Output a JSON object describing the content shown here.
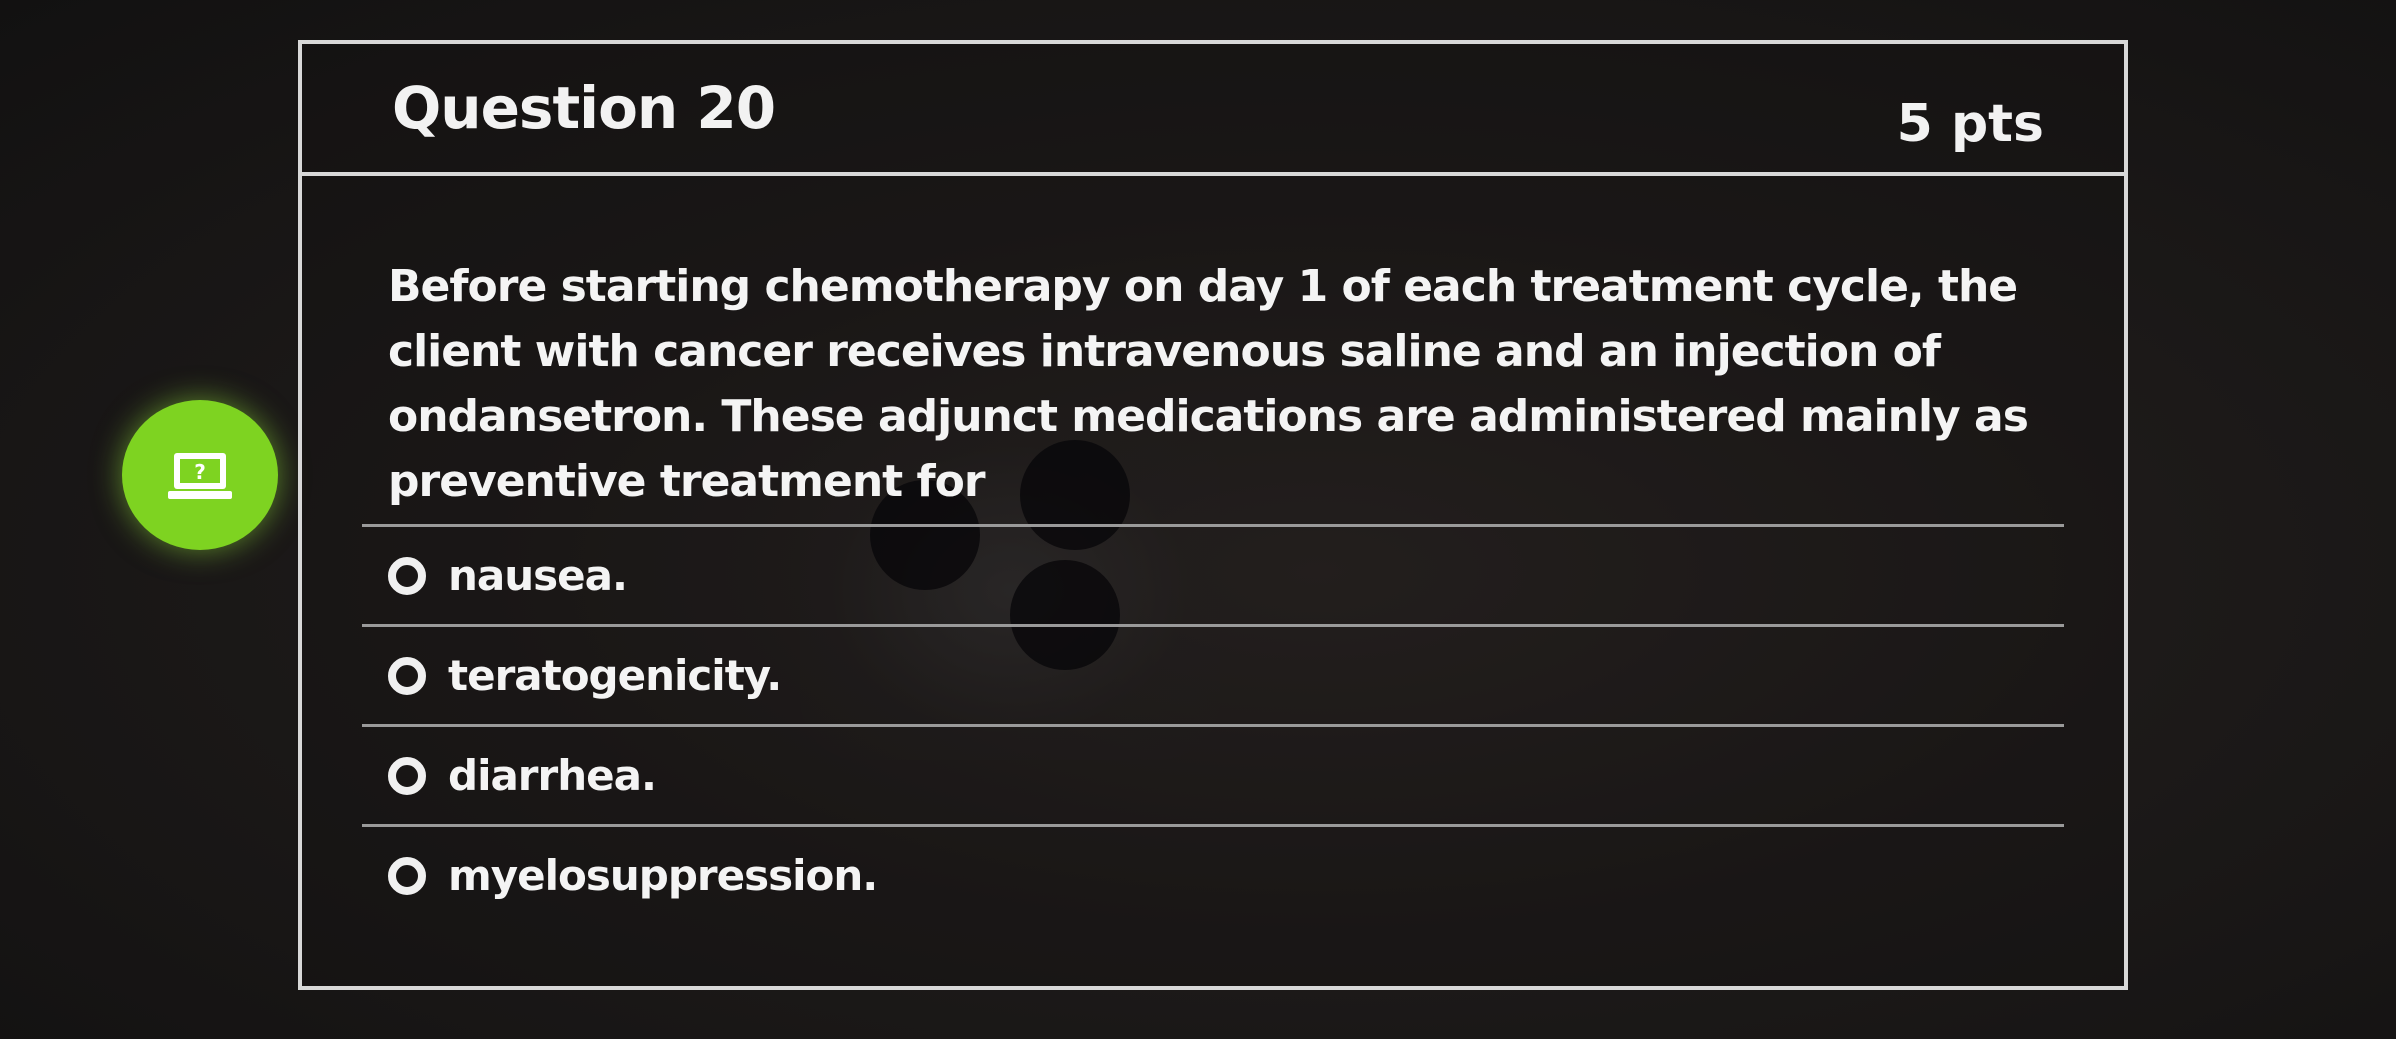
{
  "question": {
    "title": "Question 20",
    "points": "5 pts",
    "text": "Before starting chemotherapy on day 1 of each treatment cycle, the client with cancer receives intravenous saline and an injection of ondansetron. These adjunct medications are administered mainly as preventive treatment for",
    "answers": [
      {
        "label": "nausea."
      },
      {
        "label": "teratogenicity."
      },
      {
        "label": "diarrhea."
      },
      {
        "label": "myelosuppression."
      }
    ]
  },
  "side_button": {
    "icon": "laptop-question-icon",
    "color": "#7ed321"
  }
}
